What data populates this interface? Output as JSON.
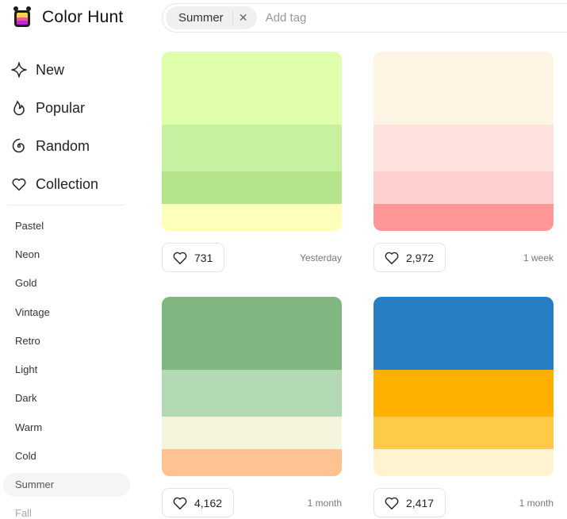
{
  "header": {
    "logo_text": "Color Hunt",
    "search": {
      "tag": "Summer",
      "placeholder": "Add tag",
      "value": ""
    }
  },
  "nav": [
    {
      "label": "New",
      "icon": "sparkle-icon"
    },
    {
      "label": "Popular",
      "icon": "flame-icon"
    },
    {
      "label": "Random",
      "icon": "spiral-icon"
    },
    {
      "label": "Collection",
      "icon": "heart-icon"
    }
  ],
  "tags": [
    "Pastel",
    "Neon",
    "Gold",
    "Vintage",
    "Retro",
    "Light",
    "Dark",
    "Warm",
    "Cold",
    "Summer",
    "Fall"
  ],
  "active_tag": "Summer",
  "palettes": [
    {
      "colors": [
        "#E0FFAD",
        "#C7F1A0",
        "#B5E48A",
        "#FEFFB8"
      ],
      "likes": "731",
      "date": "Yesterday"
    },
    {
      "colors": [
        "#FDF4E3",
        "#FFE1DD",
        "#FFD0CF",
        "#FF9697"
      ],
      "likes": "2,972",
      "date": "1 week"
    },
    {
      "colors": [
        "#80B67F",
        "#B2D8B4",
        "#F6F4DC",
        "#FFC290"
      ],
      "likes": "4,162",
      "date": "1 month"
    },
    {
      "colors": [
        "#287EC2",
        "#FEB001",
        "#FFCA45",
        "#FFF3D0"
      ],
      "likes": "2,417",
      "date": "1 month"
    }
  ]
}
